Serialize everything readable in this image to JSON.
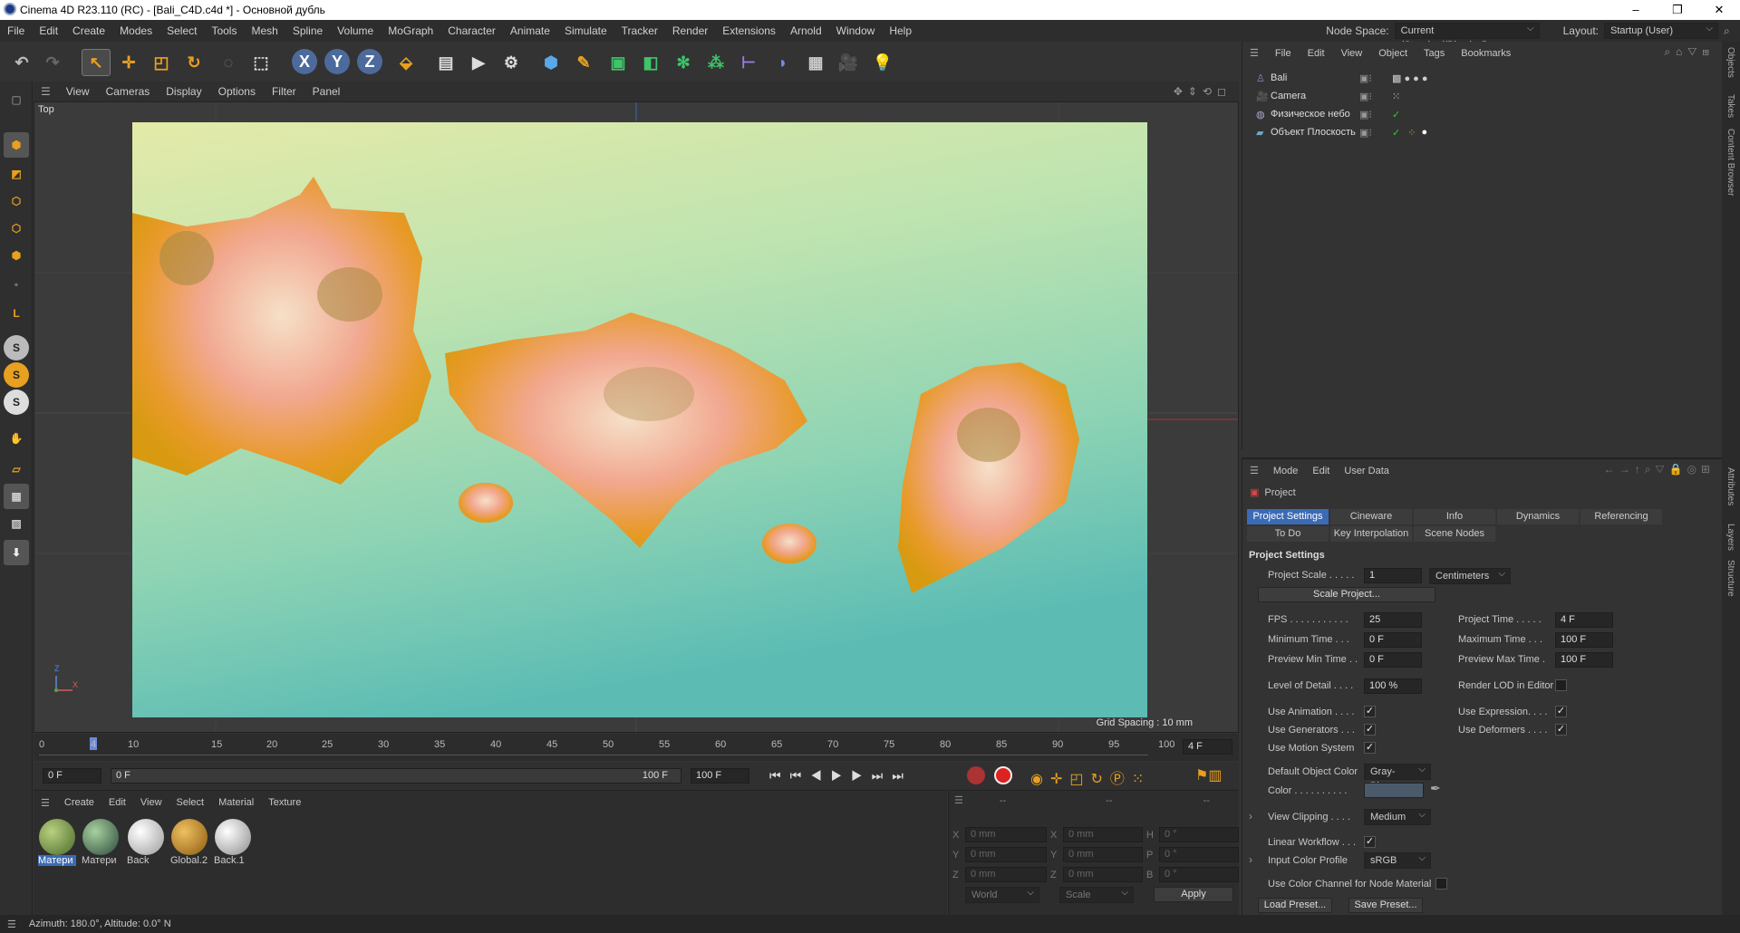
{
  "titlebar": {
    "title": "Cinema 4D R23.110 (RC) - [Bali_C4D.c4d *] - Основной дубль",
    "minimize": "–",
    "maximize": "❐",
    "close": "✕"
  },
  "menu": {
    "items": [
      "File",
      "Edit",
      "Create",
      "Modes",
      "Select",
      "Tools",
      "Mesh",
      "Spline",
      "Volume",
      "MoGraph",
      "Character",
      "Animate",
      "Simulate",
      "Tracker",
      "Render",
      "Extensions",
      "Arnold",
      "Window",
      "Help"
    ],
    "node_space_label": "Node Space:",
    "node_space_value": "Current (Standard/Physical)",
    "layout_label": "Layout:",
    "layout_value": "Startup (User)"
  },
  "viewport": {
    "menu": [
      "View",
      "Cameras",
      "Display",
      "Options",
      "Filter",
      "Panel"
    ],
    "view_name": "Top",
    "grid_spacing": "Grid Spacing : 10 mm",
    "axis_z": "Z",
    "axis_x": "X"
  },
  "timeline": {
    "ticks": [
      "0",
      "5",
      "10",
      "15",
      "20",
      "25",
      "30",
      "35",
      "40",
      "45",
      "50",
      "55",
      "60",
      "65",
      "70",
      "75",
      "80",
      "85",
      "90",
      "95",
      "100"
    ],
    "current_marker": "4",
    "current_frame_field": "4 F"
  },
  "transport": {
    "start": "0 F",
    "range_start": "0 F",
    "range_end": "100 F",
    "end": "100 F"
  },
  "materials": {
    "menu": [
      "Create",
      "Edit",
      "View",
      "Select",
      "Material",
      "Texture"
    ],
    "items": [
      {
        "name": "Матери",
        "color": "#6a8a3a"
      },
      {
        "name": "Матери",
        "color": "#4a6a4a"
      },
      {
        "name": "Back",
        "color": "#e8e8e8"
      },
      {
        "name": "Global.2",
        "color": "#c88a20"
      },
      {
        "name": "Back.1",
        "color": "#dcdcdc"
      }
    ]
  },
  "coords": {
    "header": [
      "--",
      "--",
      "--"
    ],
    "rows": [
      {
        "a": "X",
        "av": "0 mm",
        "b": "X",
        "bv": "0 mm",
        "c": "H",
        "cv": "0 °"
      },
      {
        "a": "Y",
        "av": "0 mm",
        "b": "Y",
        "bv": "0 mm",
        "c": "P",
        "cv": "0 °"
      },
      {
        "a": "Z",
        "av": "0 mm",
        "b": "Z",
        "bv": "0 mm",
        "c": "B",
        "cv": "0 °"
      }
    ],
    "world": "World",
    "scale": "Scale",
    "apply": "Apply"
  },
  "status": {
    "text": "Azimuth: 180.0°, Altitude: 0.0°  N"
  },
  "objects": {
    "menu": [
      "File",
      "Edit",
      "View",
      "Object",
      "Tags",
      "Bookmarks"
    ],
    "items": [
      "Bali",
      "Camera",
      "Физическое небо",
      "Объект Плоскость"
    ]
  },
  "rightstrip": {
    "tabs_top": [
      "Objects",
      "Takes",
      "Content Browser"
    ],
    "tabs_bottom": [
      "Attributes",
      "Layers",
      "Structure"
    ]
  },
  "attributes": {
    "menu": [
      "Mode",
      "Edit",
      "User Data"
    ],
    "object": "Project",
    "tabs_row1": [
      "Project Settings",
      "Cineware",
      "Info",
      "Dynamics",
      "Referencing"
    ],
    "tabs_row2": [
      "To Do",
      "Key Interpolation",
      "Scene Nodes"
    ],
    "section": "Project Settings",
    "project_scale_label": "Project Scale . . . . .",
    "project_scale": "1",
    "units": "Centimeters",
    "scale_project_btn": "Scale Project...",
    "fps_label": "FPS . . . . . . . . . . .",
    "fps": "25",
    "project_time_label": "Project Time . . . . .",
    "project_time": "4 F",
    "min_time_label": "Minimum Time . . .",
    "min_time": "0 F",
    "max_time_label": "Maximum Time . . .",
    "max_time": "100 F",
    "prev_min_label": "Preview Min Time . .",
    "prev_min": "0 F",
    "prev_max_label": "Preview Max Time .",
    "prev_max": "100 F",
    "lod_label": "Level of Detail . . . .",
    "lod": "100 %",
    "render_lod_label": "Render LOD in Editor",
    "use_animation_label": "Use Animation . . . .",
    "use_expression_label": "Use Expression. . . .",
    "use_generators_label": "Use Generators . . .",
    "use_deformers_label": "Use Deformers . . . .",
    "use_motion_label": "Use Motion System",
    "default_color_label": "Default Object Color",
    "default_color": "Gray-Blue",
    "color_label": "Color . . . . . . . . . .",
    "view_clipping_label": "View Clipping . . . .",
    "view_clipping": "Medium",
    "linear_wf_label": "Linear Workflow . . .",
    "input_profile_label": "Input Color Profile",
    "input_profile": "sRGB",
    "color_channel_label": "Use Color Channel for Node Material",
    "load_preset": "Load Preset...",
    "save_preset": "Save Preset..."
  },
  "colors": {
    "accent": "#3b6bb5",
    "bg": "#333333"
  }
}
